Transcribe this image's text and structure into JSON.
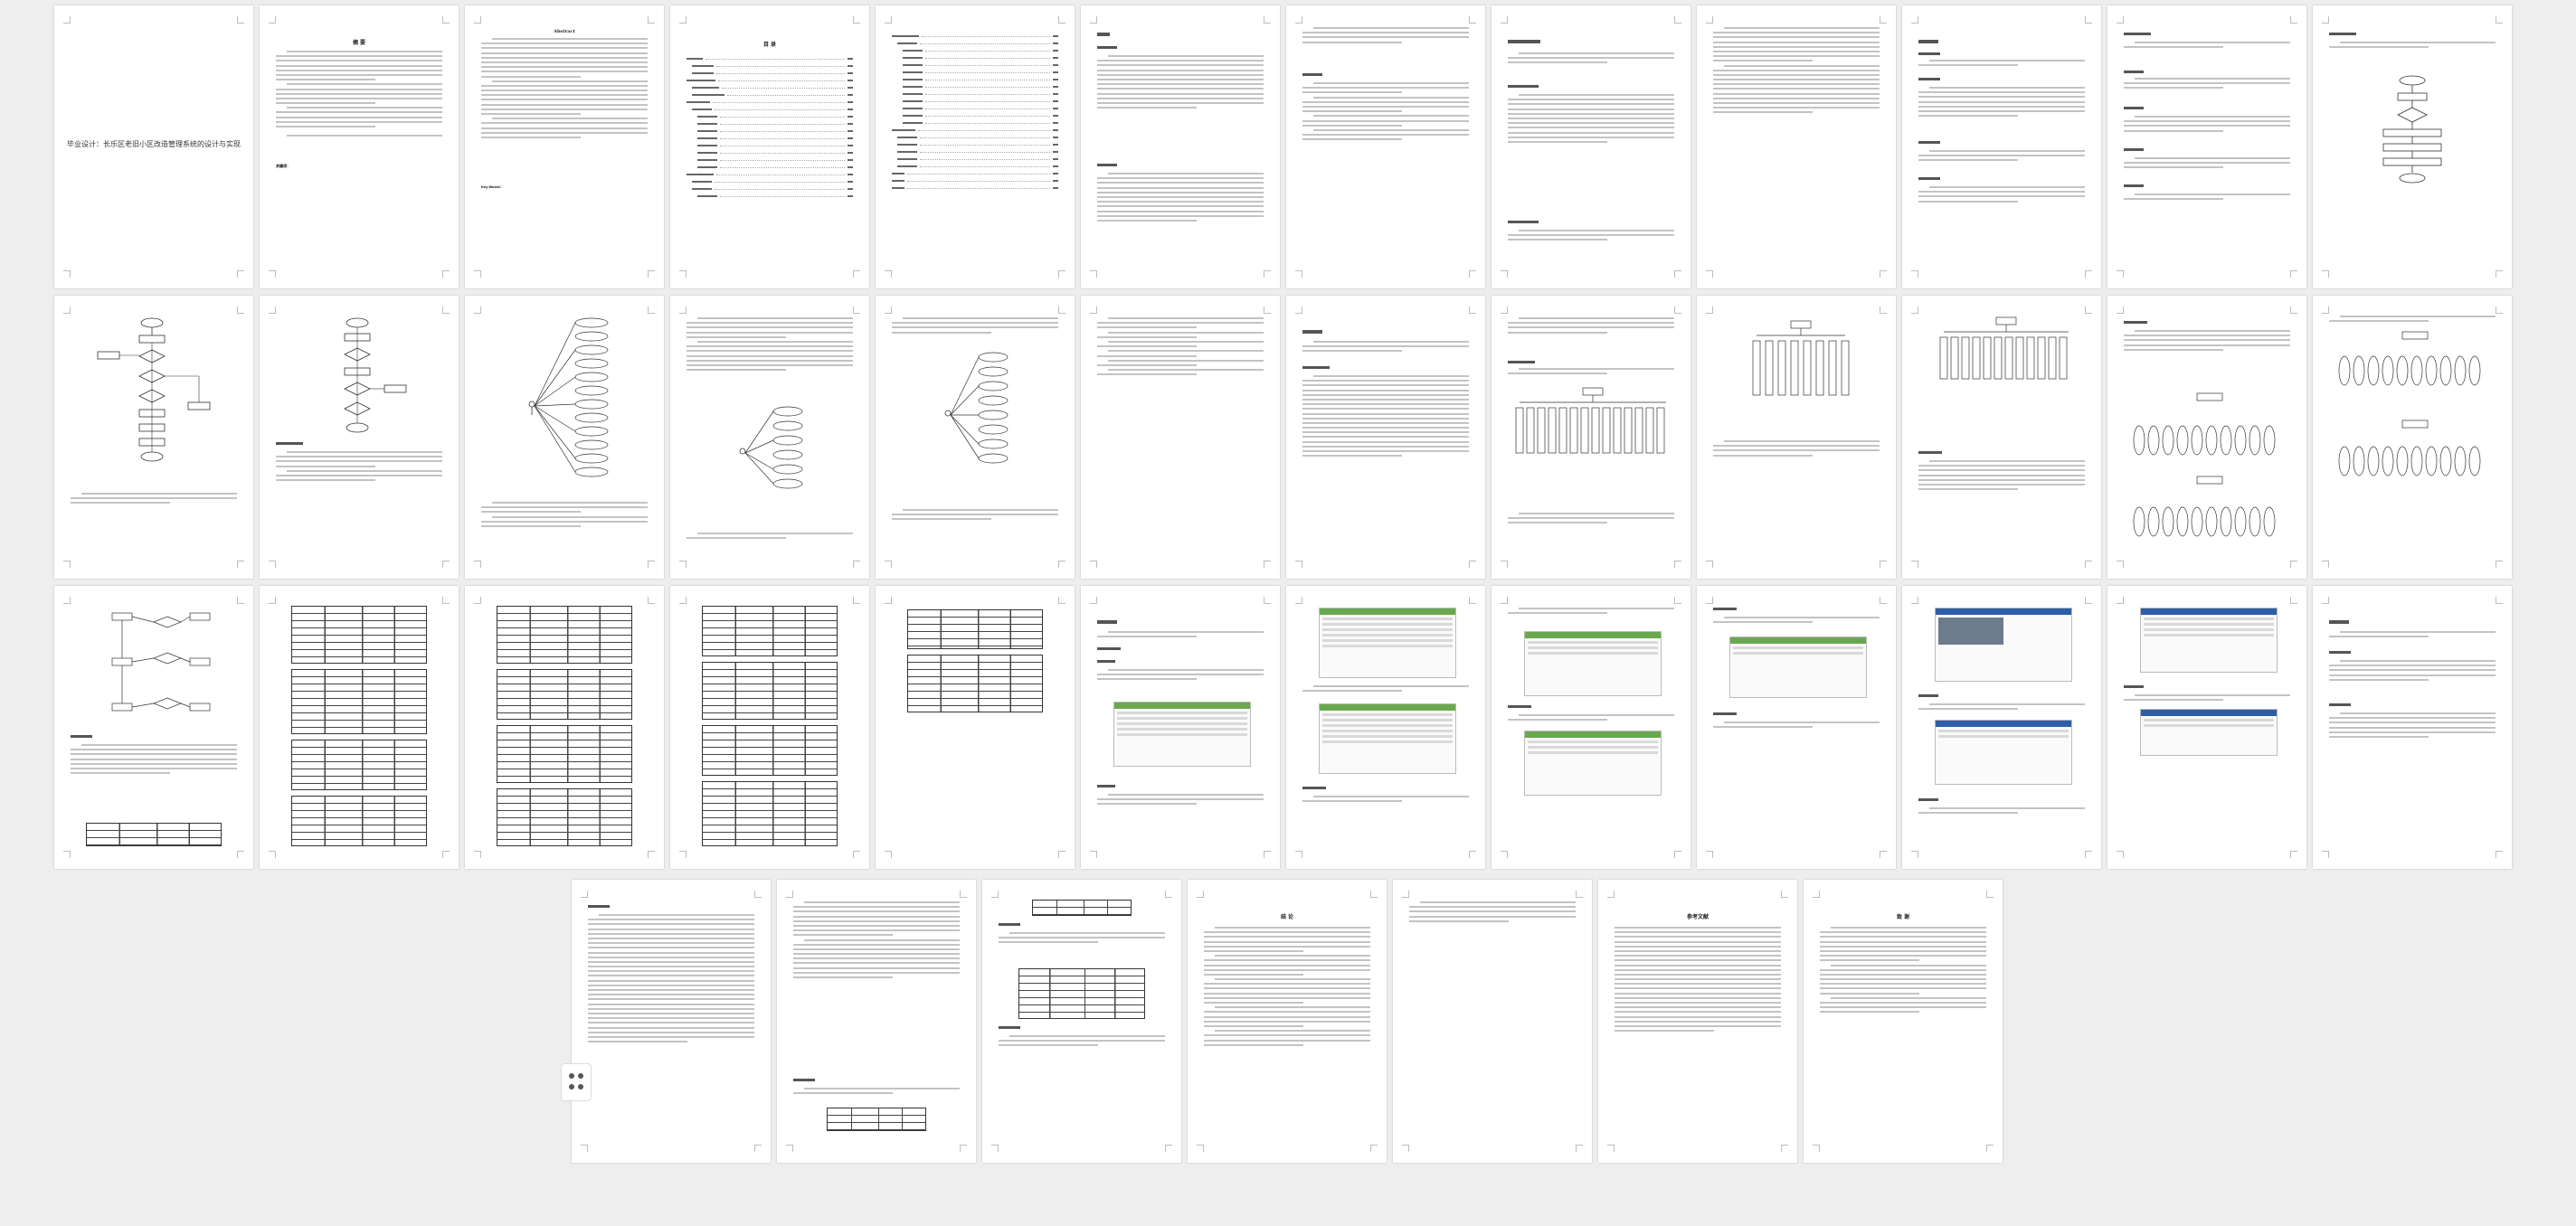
{
  "document": {
    "cover_title": "毕业设计：长乐区老旧小区改造管理系统的设计与实现",
    "abstract_cn_title": "摘  要",
    "abstract_en_title": "Abstract",
    "toc_title": "目  录",
    "keywords_cn": "关键词：",
    "keywords_en": "Key Words："
  },
  "pages_row3_caption": "",
  "pages_final": {
    "summary_title": "结  论",
    "references_title": "参考文献",
    "thanks_title": "致  谢"
  },
  "toolbar": {
    "float_icon": "grid-dots-icon"
  }
}
